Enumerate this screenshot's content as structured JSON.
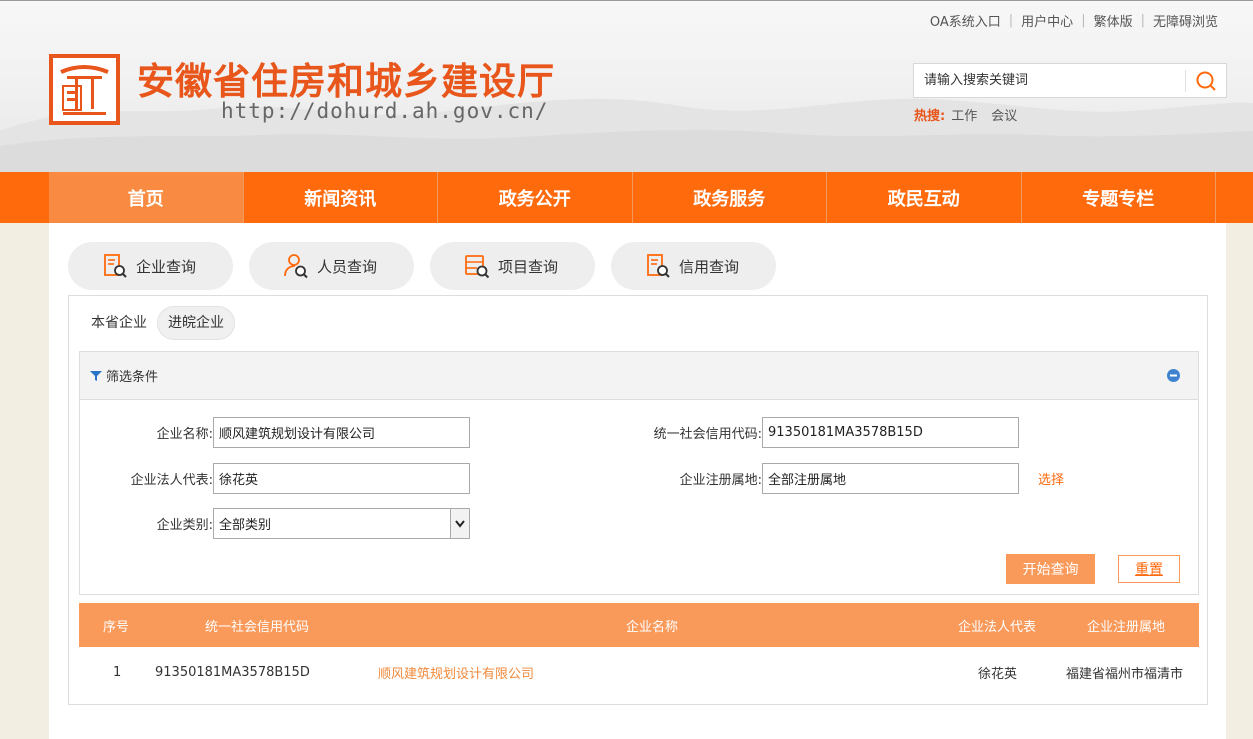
{
  "header": {
    "top_links": [
      "OA系统入口",
      "用户中心",
      "繁体版",
      "无障碍浏览"
    ],
    "site_title": "安徽省住房和城乡建设厅",
    "site_url": "http://dohurd.ah.gov.cn/",
    "search_placeholder": "请输入搜索关键词",
    "hot_label": "热搜:",
    "hot_words": [
      "工作",
      "会议"
    ]
  },
  "nav": {
    "items": [
      "首页",
      "新闻资讯",
      "政务公开",
      "政务服务",
      "政民互动",
      "专题专栏"
    ],
    "active_index": 0
  },
  "query_tabs": [
    "企业查询",
    "人员查询",
    "项目查询",
    "信用查询"
  ],
  "sub_tabs": [
    "本省企业",
    "进皖企业"
  ],
  "sub_tab_selected": 1,
  "filter": {
    "title": "筛选条件",
    "company_name_label": "企业名称:",
    "company_name_value": "顺风建筑规划设计有限公司",
    "credit_code_label": "统一社会信用代码:",
    "credit_code_value": "91350181MA3578B15D",
    "legal_rep_label": "企业法人代表:",
    "legal_rep_value": "徐花英",
    "reg_place_label": "企业注册属地:",
    "reg_place_value": "全部注册属地",
    "choose_label": "选择",
    "category_label": "企业类别:",
    "category_value": "全部类别",
    "start_button": "开始查询",
    "reset_button": "重置"
  },
  "table": {
    "columns": [
      "序号",
      "统一社会信用代码",
      "企业名称",
      "企业法人代表",
      "企业注册属地"
    ],
    "rows": [
      [
        "1",
        "91350181MA3578B15D",
        "顺风建筑规划设计有限公司",
        "徐花英",
        "福建省福州市福清市"
      ]
    ]
  },
  "colors": {
    "accent": "#ff6a0d",
    "accent_light": "#f99a5b",
    "title": "#e8561b"
  }
}
